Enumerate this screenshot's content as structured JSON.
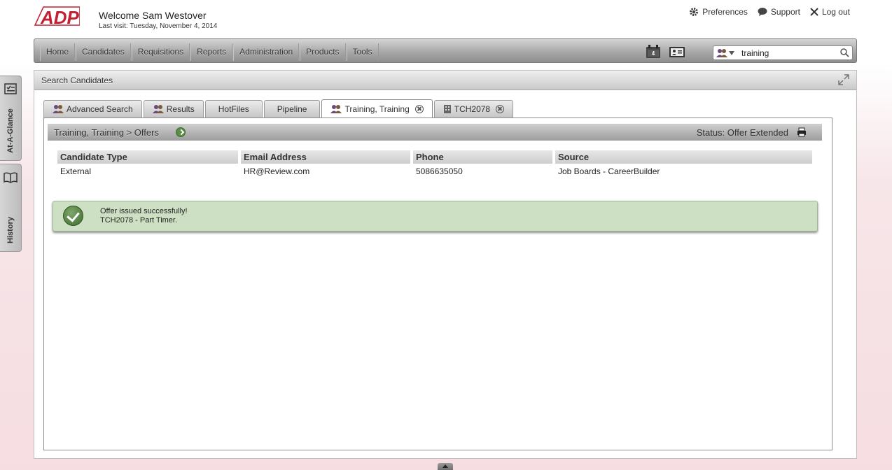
{
  "brand": {
    "logo_text": "ADP",
    "color": "#c21f32"
  },
  "header": {
    "welcome": "Welcome Sam Westover",
    "last_visit": "Last visit: Tuesday, November 4, 2014",
    "links": {
      "preferences": "Preferences",
      "support": "Support",
      "logout": "Log out"
    }
  },
  "nav": {
    "items": [
      "Home",
      "Candidates",
      "Requisitions",
      "Reports",
      "Administration",
      "Products",
      "Tools"
    ],
    "calendar_day": "4"
  },
  "search": {
    "value": "training",
    "icon": "search-icon"
  },
  "side_tabs": {
    "at_a_glance": "At-A-Glance",
    "history": "History"
  },
  "panel": {
    "title": "Search Candidates",
    "tabs": [
      {
        "label": "Advanced Search"
      },
      {
        "label": "Results"
      },
      {
        "label": "HotFiles"
      },
      {
        "label": "Pipeline"
      },
      {
        "label": "Training, Training"
      },
      {
        "label": "TCH2078"
      }
    ]
  },
  "content": {
    "breadcrumb": "Training, Training > Offers",
    "status": "Status: Offer Extended",
    "table": {
      "headers": [
        "Candidate Type",
        "Email Address",
        "Phone",
        "Source"
      ],
      "row": [
        "External",
        "HR@Review.com",
        "5086635050",
        "Job Boards - CareerBuilder"
      ]
    },
    "success": {
      "line1": "Offer issued successfully!",
      "line2": "TCH2078 - Part Timer."
    }
  }
}
